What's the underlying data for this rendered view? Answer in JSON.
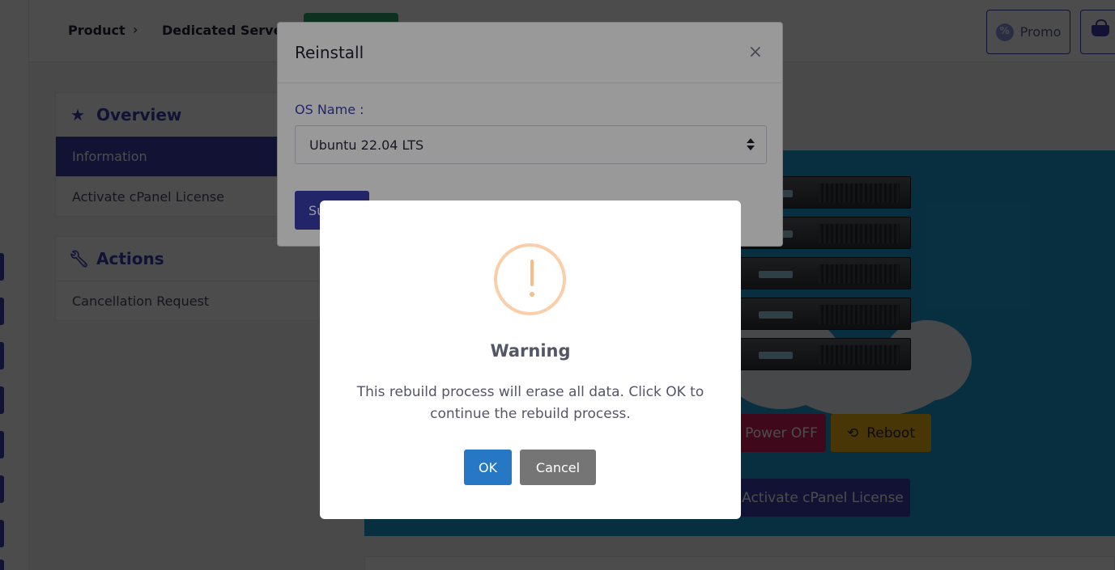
{
  "header": {
    "breadcrumbs": [
      "Product",
      "Dedicated Server"
    ],
    "breadcrumb_separator": "›",
    "promo_label": "Promo"
  },
  "sidebar": {
    "overview": {
      "title": "Overview",
      "items": [
        "Information",
        "Activate cPanel License"
      ]
    },
    "actions": {
      "title": "Actions",
      "items": [
        "Cancellation Request"
      ]
    }
  },
  "hero": {
    "power_off_label": "Power OFF",
    "reboot_label": "Reboot",
    "activate_cpanel_label": "Activate cPanel License"
  },
  "reinstall_modal": {
    "title": "Reinstall",
    "close_glyph": "×",
    "os_label": "OS Name :",
    "os_selected": "Ubuntu 22.04 LTS",
    "submit_label": "Submit"
  },
  "warning_dialog": {
    "title": "Warning",
    "message": "This rebuild process will erase all data. Click OK to continue the rebuild process.",
    "ok_label": "OK",
    "cancel_label": "Cancel",
    "icon": "exclamation-icon"
  },
  "colors": {
    "brand": "#3b3fb0",
    "hero_bg": "#1a9fd6",
    "power_off": "#d61f5c",
    "reboot": "#f2b41b",
    "ok": "#2778c4",
    "cancel": "#757575",
    "warning_ring": "#facea8"
  }
}
